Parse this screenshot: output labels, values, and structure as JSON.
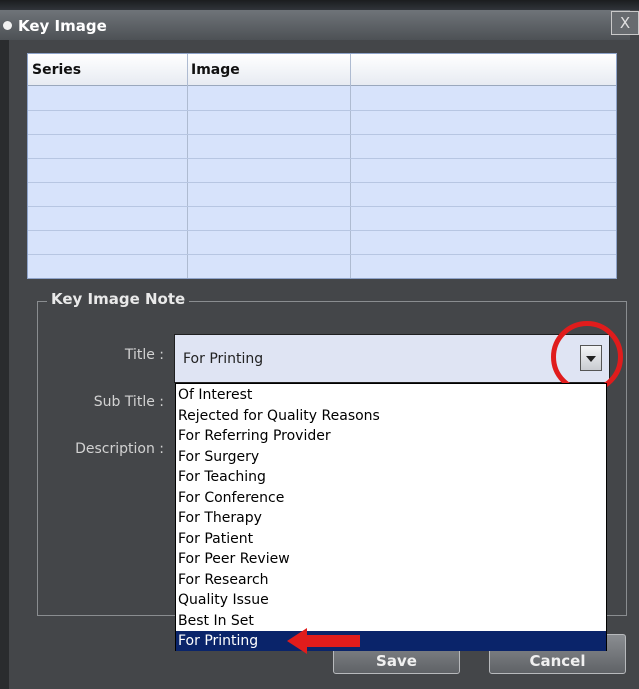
{
  "window": {
    "title": "Key Image",
    "close_symbol": "X"
  },
  "table": {
    "columns": [
      "Series",
      "Image",
      ""
    ],
    "rows": [
      [
        "",
        "",
        ""
      ],
      [
        "",
        "",
        ""
      ],
      [
        "",
        "",
        ""
      ],
      [
        "",
        "",
        ""
      ],
      [
        "",
        "",
        ""
      ],
      [
        "",
        "",
        ""
      ],
      [
        "",
        "",
        ""
      ],
      [
        "",
        "",
        ""
      ]
    ]
  },
  "note": {
    "legend": "Key Image Note",
    "title_label": "Title :",
    "subtitle_label": "Sub Title :",
    "description_label": "Description :",
    "title_value": "For Printing"
  },
  "dropdown": {
    "options": [
      "Of Interest",
      "Rejected for Quality Reasons",
      "For Referring Provider",
      "For Surgery",
      "For Teaching",
      "For Conference",
      "For Therapy",
      "For Patient",
      "For Peer Review",
      "For Research",
      "Quality Issue",
      "Best In Set",
      "For Printing"
    ],
    "selected": "For Printing"
  },
  "buttons": {
    "save": "Save",
    "cancel": "Cancel"
  },
  "annotations": {
    "highlight_color": "#e01c1c"
  }
}
